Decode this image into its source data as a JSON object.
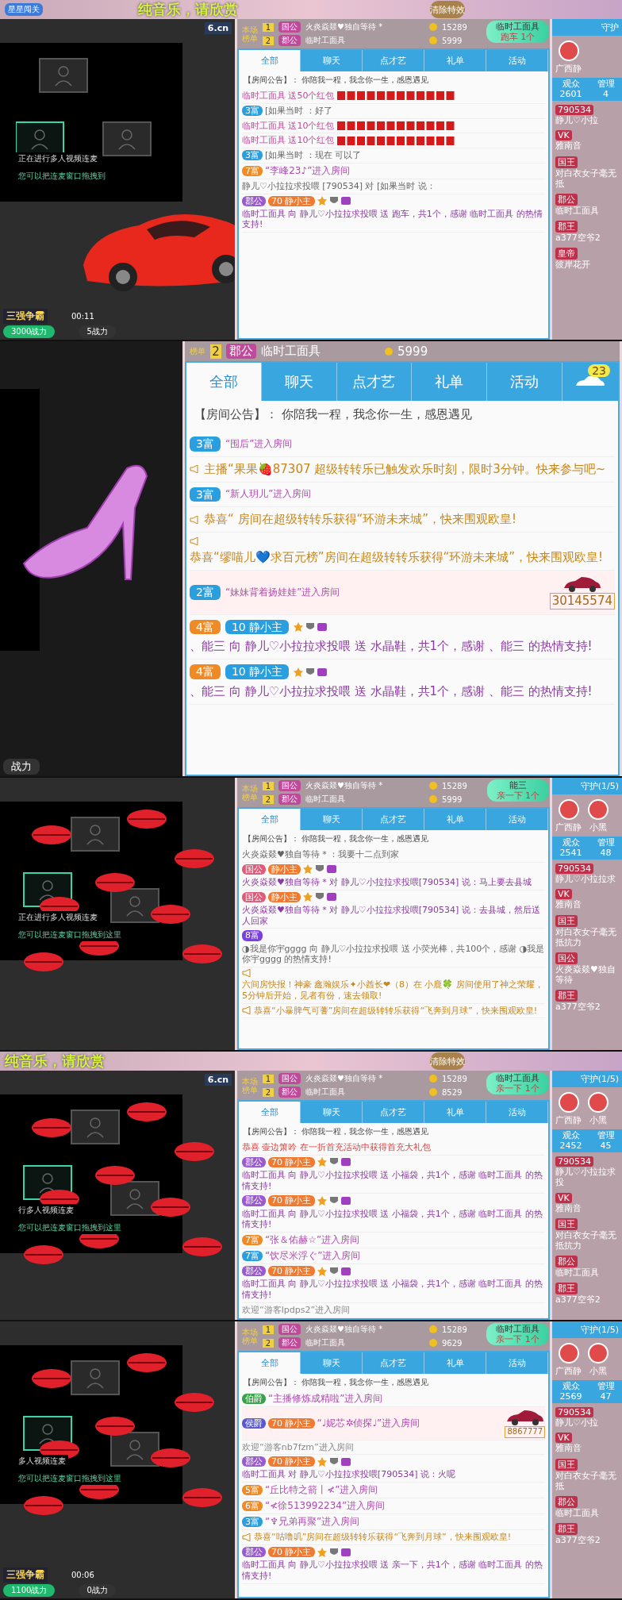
{
  "frames": [
    {
      "kind": "normal",
      "top_bar": {
        "title": "纯音乐，请欣赏",
        "stage": "星星闯关"
      },
      "video": {
        "logo": "6.cn",
        "kind": "car",
        "line1": "正在进行多人视频连麦",
        "line2": "您可以把连麦窗口拖拽到",
        "bottom": {
          "title": "三强争霸",
          "time": "00:11",
          "left_power": "3000战力",
          "right_power": "5战力"
        }
      },
      "clear_button": "清除特效",
      "ranking": {
        "label": "本场榜单",
        "rows": [
          {
            "rank": "1",
            "badge": "国公",
            "name": "火炎焱燚♥独自等待 *",
            "coins": "15289"
          },
          {
            "rank": "2",
            "badge": "郡公",
            "name": "临时工面具",
            "coins": "5999"
          }
        ]
      },
      "tabs": [
        {
          "label": "全部",
          "selected": true
        },
        {
          "label": "聊天",
          "selected": false
        },
        {
          "label": "点才艺",
          "selected": false
        },
        {
          "label": "礼单",
          "selected": false
        },
        {
          "label": "活动",
          "selected": false
        }
      ],
      "toast": {
        "name": "临时工面具",
        "gift": "跑车 1个"
      },
      "announcement": "【房间公告】： 你陪我一程，我念你一生，感恩遇见",
      "messages": [
        {
          "kind": "redpacket",
          "text": "临时工面具 送50个红包"
        },
        {
          "kind": "chat",
          "badges": [
            {
              "label": "3富",
              "color": "#2a9fe0"
            }
          ],
          "text": "[如果当时 ：好了"
        },
        {
          "kind": "redpacket",
          "text": "临时工面具 送10个红包"
        },
        {
          "kind": "redpacket",
          "text": "临时工面具 送10个红包"
        },
        {
          "kind": "chat",
          "badges": [
            {
              "label": "3富",
              "color": "#2a9fe0"
            }
          ],
          "text": "[如果当时 ：现在 可以了"
        },
        {
          "kind": "enter",
          "badges": [
            {
              "label": "7富",
              "color": "#f08a24"
            }
          ],
          "text": "“李峰23♪”进入房间"
        },
        {
          "kind": "chat",
          "text": "静儿♡小拉拉求投喂 [790534] 对 [如果当时 说："
        },
        {
          "kind": "gift",
          "badges": [
            {
              "label": "郡公",
              "color": "#9b59d0"
            },
            {
              "label": "70 静小主",
              "color": "#f07a30"
            }
          ],
          "text": "临时工面具 向 静儿♡小拉拉求投喂 送 跑车，共1个，感谢 临时工面具 的热情支持!"
        }
      ],
      "sidebar": {
        "header": "守护",
        "guards": [
          "广西静"
        ],
        "viewers_label": "观众",
        "viewers": "2601",
        "admins_label": "管理",
        "admins": "4",
        "list": [
          {
            "badge": "790534",
            "name": "静儿♡小拉"
          },
          {
            "badge": "VK",
            "name": "雅南音"
          },
          {
            "badge": "国王",
            "name": "对白衣女子毫无抵"
          },
          {
            "badge": "郡公",
            "name": "临时工面具"
          },
          {
            "badge": "郡王",
            "name": "a377空爷2"
          },
          {
            "badge": "皇帝",
            "name": "彼岸花开"
          }
        ]
      }
    },
    {
      "kind": "zoomed",
      "video": {
        "kind": "shoe",
        "bottom": {
          "left_power": "战力"
        }
      },
      "ranking": {
        "label": "榜单",
        "rows": [
          {
            "rank": "2",
            "badge": "郡公",
            "name": "临时工面具",
            "coins": "5999"
          }
        ]
      },
      "tabs": [
        {
          "label": "全部",
          "selected": true
        },
        {
          "label": "聊天",
          "selected": false
        },
        {
          "label": "点才艺",
          "selected": false
        },
        {
          "label": "礼单",
          "selected": false
        },
        {
          "label": "活动",
          "selected": false
        }
      ],
      "car_count": "23",
      "announcement": "【房间公告】： 你陪我一程，我念你一生，感恩遇见",
      "messages": [
        {
          "kind": "enter",
          "badges": [
            {
              "label": "3富",
              "color": "#2a9fe0"
            }
          ],
          "text": "“围后”进入房间"
        },
        {
          "kind": "notice",
          "text": "主播“果果🍓87307 超级转转乐已触发欢乐时刻，限时3分钟。快来参与吧~"
        },
        {
          "kind": "enter",
          "badges": [
            {
              "label": "3富",
              "color": "#2a9fe0"
            }
          ],
          "text": "“新人玥儿”进入房间"
        },
        {
          "kind": "notice",
          "text": "恭喜“ 房间在超级转转乐获得“环游未来城”，快来围观欧皇!"
        },
        {
          "kind": "notice",
          "text": "恭喜“缪喵儿💙求百元榜”房间在超级转转乐获得“环游未来城”，快来围观欧皇!"
        },
        {
          "kind": "enter",
          "badges": [
            {
              "label": "2富",
              "color": "#2a9fe0"
            }
          ],
          "text": "“妹妹背着扬娃娃”进入房间",
          "car_number": "30145574"
        },
        {
          "kind": "gift",
          "badges": [
            {
              "label": "4富",
              "color": "#f08a24"
            },
            {
              "label": "10 静小主",
              "color": "#2a9fe0"
            }
          ],
          "text": "、能三 向 静儿♡小拉拉求投喂 送 水晶鞋，共1个，感谢 、能三 的热情支持!"
        },
        {
          "kind": "gift",
          "badges": [
            {
              "label": "4富",
              "color": "#f08a24"
            },
            {
              "label": "10 静小主",
              "color": "#2a9fe0"
            }
          ],
          "text": "、能三 向 静儿♡小拉拉求投喂 送 水晶鞋，共1个，感谢 、能三 的热情支持!"
        }
      ]
    },
    {
      "kind": "normal",
      "video": {
        "kind": "lips",
        "line1": "正在进行多人视频连麦",
        "line2": "您可以把连麦窗口拖拽到这里"
      },
      "ranking": {
        "label": "本场榜单",
        "rows": [
          {
            "rank": "1",
            "badge": "国公",
            "name": "火炎焱燚♥独自等待 *",
            "coins": "15289"
          },
          {
            "rank": "2",
            "badge": "郡公",
            "name": "临时工面具",
            "coins": "5999"
          }
        ]
      },
      "tabs": [
        {
          "label": "全部",
          "selected": true
        },
        {
          "label": "聊天",
          "selected": false
        },
        {
          "label": "点才艺",
          "selected": false
        },
        {
          "label": "礼单",
          "selected": false
        },
        {
          "label": "活动",
          "selected": false
        }
      ],
      "toast": {
        "name": "能三",
        "gift": "亲一下 1个"
      },
      "announcement": "【房间公告】： 你陪我一程，我念你一生，感恩遇见",
      "messages": [
        {
          "kind": "chat",
          "text": "火炎焱燚♥独自等待 * ：我要十二点到家"
        },
        {
          "kind": "gift",
          "badges": [
            {
              "label": "国公",
              "color": "#e05a7a"
            },
            {
              "label": "静小主",
              "color": "#f07a30"
            }
          ],
          "text": "火炎焱燚♥独自等待 * 对 静儿♡小拉拉求投喂[790534] 说：马上要去县城"
        },
        {
          "kind": "gift",
          "badges": [
            {
              "label": "国公",
              "color": "#e05a7a"
            },
            {
              "label": "静小主",
              "color": "#f07a30"
            }
          ],
          "text": "火炎焱燚♥独自等待 * 对 静儿♡小拉拉求投喂[790534] 说：去县城，然后送人回家"
        },
        {
          "kind": "chat",
          "badges": [
            {
              "label": "8富",
              "color": "#7b3fe0"
            }
          ],
          "text": "◑我是你宇gggg 向 静儿♡小拉拉求投喂 送 小荧光棒，共100个，感谢 ◑我是你宇gggg 的热情支持!"
        },
        {
          "kind": "notice",
          "text": "六间房快报！神豪 鑫瀚娱乐✦小酋长❤（8）在 小鹿🍀 房间使用了神之荣耀，5分钟后开始，见者有份，速去领取!"
        },
        {
          "kind": "notice",
          "text": "恭喜“小暴脾气可蓍”房间在超级转转乐获得“飞奔到月球”，快来围观欧皇!"
        }
      ],
      "sidebar": {
        "header": "守护(1/5)",
        "guards": [
          "广西静",
          "小黑"
        ],
        "viewers_label": "观众",
        "viewers": "2541",
        "admins_label": "管理",
        "admins": "48",
        "list": [
          {
            "badge": "790534",
            "name": "静儿♡小拉拉求"
          },
          {
            "badge": "VK",
            "name": "雅南音"
          },
          {
            "badge": "国王",
            "name": "对白衣女子毫无抵抗力"
          },
          {
            "badge": "国公",
            "name": "火炎焱燚♥独自等待"
          },
          {
            "badge": "郡王",
            "name": "a377空爷2"
          }
        ]
      }
    },
    {
      "kind": "normal",
      "top_bar": {
        "title": "纯音乐，请欣赏"
      },
      "video": {
        "logo": "6.cn",
        "kind": "lips",
        "line1": "行多人视频连麦",
        "line2": "您可以把连麦窗口拖拽到这里"
      },
      "clear_button": "清除特效",
      "ranking": {
        "label": "本场榜单",
        "rows": [
          {
            "rank": "1",
            "badge": "国公",
            "name": "火炎焱燚♥独自等待 *",
            "coins": "15289"
          },
          {
            "rank": "2",
            "badge": "郡公",
            "name": "临时工面具",
            "coins": "8529"
          }
        ]
      },
      "tabs": [
        {
          "label": "全部",
          "selected": true
        },
        {
          "label": "聊天",
          "selected": false
        },
        {
          "label": "点才艺",
          "selected": false
        },
        {
          "label": "礼单",
          "selected": false
        },
        {
          "label": "活动",
          "selected": false
        }
      ],
      "toast": {
        "name": "临时工面具",
        "gift": "亲一下 1个"
      },
      "announcement": "【房间公告】： 你陪我一程，我念你一生，感恩遇见",
      "messages": [
        {
          "kind": "alert",
          "text": "恭喜 壶边箫吟 在一折首充活动中获得首充大礼包"
        },
        {
          "kind": "gift",
          "badges": [
            {
              "label": "郡公",
              "color": "#9b59d0"
            },
            {
              "label": "70 静小主",
              "color": "#f07a30"
            }
          ],
          "text": "临时工面具 向 静儿♡小拉拉求投喂 送 小福袋，共1个，感谢 临时工面具 的热情支持!"
        },
        {
          "kind": "gift",
          "badges": [
            {
              "label": "郡公",
              "color": "#9b59d0"
            },
            {
              "label": "70 静小主",
              "color": "#f07a30"
            }
          ],
          "text": "临时工面具 向 静儿♡小拉拉求投喂 送 小福袋，共1个，感谢 临时工面具 的热情支持!"
        },
        {
          "kind": "enter",
          "badges": [
            {
              "label": "7富",
              "color": "#f08a24"
            }
          ],
          "text": "“张＆佑赫☆”进入房间"
        },
        {
          "kind": "enter",
          "badges": [
            {
              "label": "7富",
              "color": "#2a9fe0"
            }
          ],
          "text": "“饮尽米浮ぐ”进入房间"
        },
        {
          "kind": "gift",
          "badges": [
            {
              "label": "郡公",
              "color": "#9b59d0"
            },
            {
              "label": "70 静小主",
              "color": "#f07a30"
            }
          ],
          "text": "临时工面具 向 静儿♡小拉拉求投喂 送 小福袋，共1个，感谢 临时工面具 的热情支持!"
        },
        {
          "kind": "plain",
          "text": "欢迎“游客lpdps2”进入房间"
        }
      ],
      "sidebar": {
        "header": "守护(1/5)",
        "guards": [
          "广西静",
          "小黑"
        ],
        "viewers_label": "观众",
        "viewers": "2452",
        "admins_label": "管理",
        "admins": "45",
        "list": [
          {
            "badge": "790534",
            "name": "静儿♡小拉拉求投"
          },
          {
            "badge": "VK",
            "name": "雅南音"
          },
          {
            "badge": "国王",
            "name": "对白衣女子毫无抵抗力"
          },
          {
            "badge": "郡公",
            "name": "临时工面具"
          },
          {
            "badge": "郡王",
            "name": "a377空爷2"
          }
        ]
      }
    },
    {
      "kind": "normal",
      "video": {
        "kind": "lips",
        "line1": "多人视频连麦",
        "line2": "您可以把连麦窗口拖拽到这里",
        "bottom": {
          "title": "三强争霸",
          "time": "00:06",
          "left_power": "1100战力",
          "right_power": "0战力"
        }
      },
      "ranking": {
        "label": "本场榜单",
        "rows": [
          {
            "rank": "1",
            "badge": "国公",
            "name": "火炎焱燚♥独自等待 *",
            "coins": "15289"
          },
          {
            "rank": "2",
            "badge": "郡公",
            "name": "临时工面具",
            "coins": "9629"
          }
        ]
      },
      "tabs": [
        {
          "label": "全部",
          "selected": true
        },
        {
          "label": "聊天",
          "selected": false
        },
        {
          "label": "点才艺",
          "selected": false
        },
        {
          "label": "礼单",
          "selected": false
        },
        {
          "label": "活动",
          "selected": false
        }
      ],
      "toast": {
        "name": "临时工面具",
        "gift": "亲一下 1个"
      },
      "announcement": "【房间公告】： 你陪我一程，我念你一生，感恩遇见",
      "messages": [
        {
          "kind": "enter",
          "badges": [
            {
              "label": "伯爵",
              "color": "#3aa04a"
            }
          ],
          "text": "“主播修炼成精啦”进入房间"
        },
        {
          "kind": "enter",
          "badges": [
            {
              "label": "侯爵",
              "color": "#5a5ad0"
            },
            {
              "label": "70 静小主",
              "color": "#f07a30"
            }
          ],
          "text": "“♩妮芯✲侦探♩”进入房间",
          "car_number": "8867777"
        },
        {
          "kind": "plain",
          "text": "欢迎“游客nb7fzm”进入房间"
        },
        {
          "kind": "gift",
          "badges": [
            {
              "label": "郡公",
              "color": "#9b59d0"
            },
            {
              "label": "70 静小主",
              "color": "#f07a30"
            }
          ],
          "text": "临时工面具 对 静儿♡小拉拉求投喂[790534] 说：火呢"
        },
        {
          "kind": "enter",
          "badges": [
            {
              "label": "5富",
              "color": "#f08a24"
            }
          ],
          "text": "“丘比特之箭丨≮”进入房间"
        },
        {
          "kind": "enter",
          "badges": [
            {
              "label": "6富",
              "color": "#f08a24"
            }
          ],
          "text": "“≮徐513992234”进入房间"
        },
        {
          "kind": "enter",
          "badges": [
            {
              "label": "3富",
              "color": "#2a9fe0"
            }
          ],
          "text": "“♆兄弟再聚”进入房间"
        },
        {
          "kind": "notice",
          "text": "恭喜“咕噜叽”房间在超级转转乐获得“飞奔到月球”，快来围观欧皇!"
        },
        {
          "kind": "gift",
          "badges": [
            {
              "label": "郡公",
              "color": "#9b59d0"
            },
            {
              "label": "70 静小主",
              "color": "#f07a30"
            }
          ],
          "text": "临时工面具 向 静儿♡小拉拉求投喂 送 亲一下，共1个，感谢 临时工面具 的热情支持!"
        }
      ],
      "sidebar": {
        "header": "守护(1/5)",
        "guards": [
          "广西静",
          "小黑"
        ],
        "viewers_label": "观众",
        "viewers": "2569",
        "admins_label": "管理",
        "admins": "47",
        "list": [
          {
            "badge": "790534",
            "name": "静儿♡小拉"
          },
          {
            "badge": "VK",
            "name": "雅南音"
          },
          {
            "badge": "国王",
            "name": "对白衣女子毫无抵"
          },
          {
            "badge": "郡公",
            "name": "临时工面具"
          },
          {
            "badge": "郡王",
            "name": "a377空爷2"
          }
        ]
      }
    }
  ]
}
